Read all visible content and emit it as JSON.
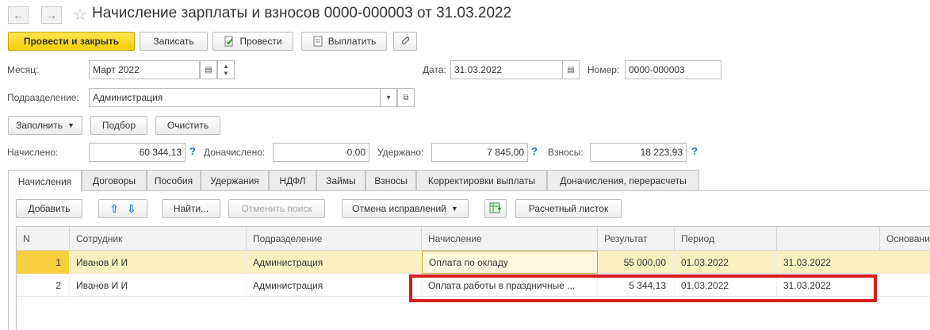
{
  "window": {
    "title": "Начисление зарплаты и взносов 0000-000003 от 31.03.2022"
  },
  "toolbar": {
    "post_close": "Провести и закрыть",
    "save": "Записать",
    "post": "Провести",
    "pay": "Выплатить"
  },
  "header": {
    "month_label": "Месяц:",
    "month_value": "Март 2022",
    "date_label": "Дата:",
    "date_value": "31.03.2022",
    "number_label": "Номер:",
    "number_value": "0000-000003",
    "department_label": "Подразделение:",
    "department_value": "Администрация"
  },
  "actions": {
    "fill": "Заполнить",
    "pick": "Подбор",
    "clear": "Очистить"
  },
  "totals": {
    "accrued_label": "Начислено:",
    "accrued_value": "60 344,13",
    "extra_label": "Доначислено:",
    "extra_value": "0,00",
    "withheld_label": "Удержано:",
    "withheld_value": "7 845,00",
    "contrib_label": "Взносы:",
    "contrib_value": "18 223,93"
  },
  "tabs": [
    "Начисления",
    "Договоры",
    "Пособия",
    "Удержания",
    "НДФЛ",
    "Займы",
    "Взносы",
    "Корректировки выплаты",
    "Доначисления, перерасчеты"
  ],
  "grid_toolbar": {
    "add": "Добавить",
    "find": "Найти...",
    "cancel_search": "Отменить поиск",
    "cancel_fixes": "Отмена исправлений",
    "payslip": "Расчетный листок"
  },
  "table": {
    "columns": [
      "N",
      "Сотрудник",
      "Подразделение",
      "Начисление",
      "Результат",
      "Период",
      "",
      "Основание"
    ],
    "rows": [
      {
        "n": "1",
        "employee": "Иванов И И",
        "department": "Администрация",
        "accrual": "Оплата по окладу",
        "result": "55 000,00",
        "from": "01.03.2022",
        "to": "31.03.2022"
      },
      {
        "n": "2",
        "employee": "Иванов И И",
        "department": "Администрация",
        "accrual": "Оплата работы в праздничные ...",
        "result": "5 344,13",
        "from": "01.03.2022",
        "to": "31.03.2022"
      }
    ]
  },
  "colors": {
    "primary_button": "#f5cf00",
    "selected_row": "#fbf0c0",
    "highlight_frame": "#d91c1c",
    "help_link": "#1b73c8"
  }
}
